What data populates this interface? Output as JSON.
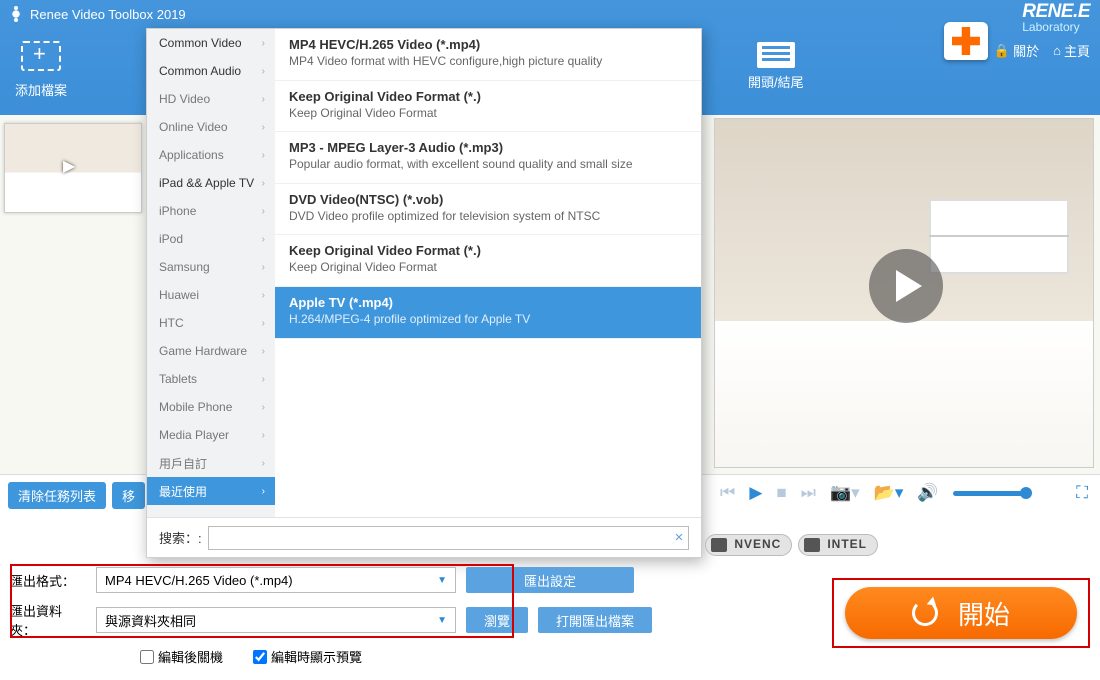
{
  "app": {
    "title": "Renee Video Toolbox 2019"
  },
  "brand": {
    "name": "RENE.E",
    "sub": "Laboratory",
    "about": "關於",
    "home": "主頁"
  },
  "toolbar": {
    "add_file": "添加檔案",
    "head_tail": "開頭/結尾"
  },
  "taskbar": {
    "clear": "清除任務列表",
    "move": "移"
  },
  "categories": [
    {
      "label": "Common Video",
      "dark": true
    },
    {
      "label": "Common Audio",
      "dark": true
    },
    {
      "label": "HD Video"
    },
    {
      "label": "Online Video"
    },
    {
      "label": "Applications"
    },
    {
      "label": "iPad && Apple TV",
      "dark": true
    },
    {
      "label": "iPhone"
    },
    {
      "label": "iPod"
    },
    {
      "label": "Samsung"
    },
    {
      "label": "Huawei"
    },
    {
      "label": "HTC"
    },
    {
      "label": "Game Hardware"
    },
    {
      "label": "Tablets"
    },
    {
      "label": "Mobile Phone"
    },
    {
      "label": "Media Player"
    },
    {
      "label": "用戶自訂"
    },
    {
      "label": "最近使用",
      "active": true
    }
  ],
  "formats": [
    {
      "title": "MP4 HEVC/H.265 Video (*.mp4)",
      "desc": "MP4 Video format with HEVC configure,high picture quality"
    },
    {
      "title": "Keep Original Video Format (*.)",
      "desc": "Keep Original Video Format"
    },
    {
      "title": "MP3 - MPEG Layer-3 Audio (*.mp3)",
      "desc": "Popular audio format, with excellent sound quality and small size"
    },
    {
      "title": "DVD Video(NTSC) (*.vob)",
      "desc": "DVD Video profile optimized for television system of NTSC"
    },
    {
      "title": "Keep Original Video Format (*.)",
      "desc": "Keep Original Video Format"
    },
    {
      "title": "Apple TV (*.mp4)",
      "desc": "H.264/MPEG-4 profile optimized for Apple TV",
      "selected": true
    }
  ],
  "search": {
    "label": "搜索：:",
    "value": ""
  },
  "gpu": {
    "g1": "NVENC",
    "g2": "INTEL"
  },
  "export": {
    "format_label": "匯出格式：",
    "format_value": "MP4 HEVC/H.265 Video (*.mp4)",
    "settings": "匯出設定",
    "folder_label": "匯出資料夾：",
    "folder_value": "與源資料夾相同",
    "browse": "瀏覽",
    "open_folder": "打開匯出檔案",
    "chk_shutdown": "編輯後關機",
    "chk_preview": "編輯時顯示預覽"
  },
  "start": {
    "label": "開始"
  }
}
